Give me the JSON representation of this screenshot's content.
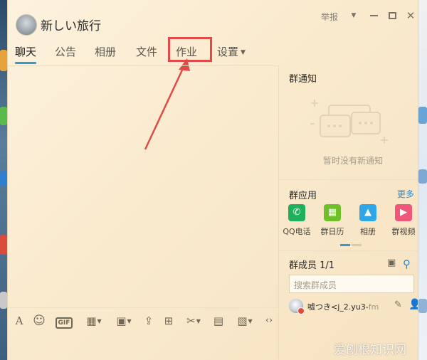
{
  "window": {
    "group_name": "新しい旅行",
    "report_label": "举报",
    "controls": {
      "dropdown": "▼",
      "minimize": "minimize",
      "maximize": "maximize",
      "close": "✕"
    }
  },
  "tabs": [
    {
      "label": "聊天",
      "active": true
    },
    {
      "label": "公告",
      "active": false
    },
    {
      "label": "相册",
      "active": false
    },
    {
      "label": "文件",
      "active": false
    },
    {
      "label": "作业",
      "active": false,
      "highlighted": true
    },
    {
      "label": "设置",
      "active": false,
      "has_dropdown": true
    }
  ],
  "annotation": {
    "color": "#e24a4a"
  },
  "toolbar": {
    "items": [
      {
        "name": "font-icon",
        "glyph": "A"
      },
      {
        "name": "emoji-icon",
        "glyph": "☺"
      },
      {
        "name": "gif-icon",
        "glyph": "GIF"
      },
      {
        "name": "gift-icon",
        "glyph": "▦"
      },
      {
        "name": "image-icon",
        "glyph": "▣"
      },
      {
        "name": "upload-icon",
        "glyph": "⇪"
      },
      {
        "name": "red-packet-icon",
        "glyph": "⊞"
      },
      {
        "name": "scissors-icon",
        "glyph": "✂"
      },
      {
        "name": "archive-icon",
        "glyph": "▤"
      },
      {
        "name": "more-apps-icon",
        "glyph": "▧"
      },
      {
        "name": "code-icon",
        "glyph": "‹›"
      }
    ]
  },
  "right_panel": {
    "notice": {
      "title": "群通知",
      "empty_text": "暂时没有新通知"
    },
    "apps": {
      "title": "群应用",
      "more_label": "更多",
      "items": [
        {
          "label": "QQ电话",
          "icon": "phone-icon",
          "color": "#20b05b"
        },
        {
          "label": "群日历",
          "icon": "calendar-icon",
          "color": "#6fbf2a"
        },
        {
          "label": "相册",
          "icon": "photo-icon",
          "color": "#2ea6e8"
        },
        {
          "label": "群视频",
          "icon": "video-icon",
          "color": "#f0587a"
        }
      ]
    },
    "members": {
      "title": "群成员 1/1",
      "search_placeholder": "搜索群成员",
      "list": [
        {
          "name": "嘘つき<j_2.yu3-",
          "name_faded": "fm"
        }
      ]
    }
  },
  "watermark": "爱刨根知识网",
  "colors": {
    "accent": "#2e9bd6",
    "link": "#2e87c8",
    "background": "#faeacd"
  }
}
